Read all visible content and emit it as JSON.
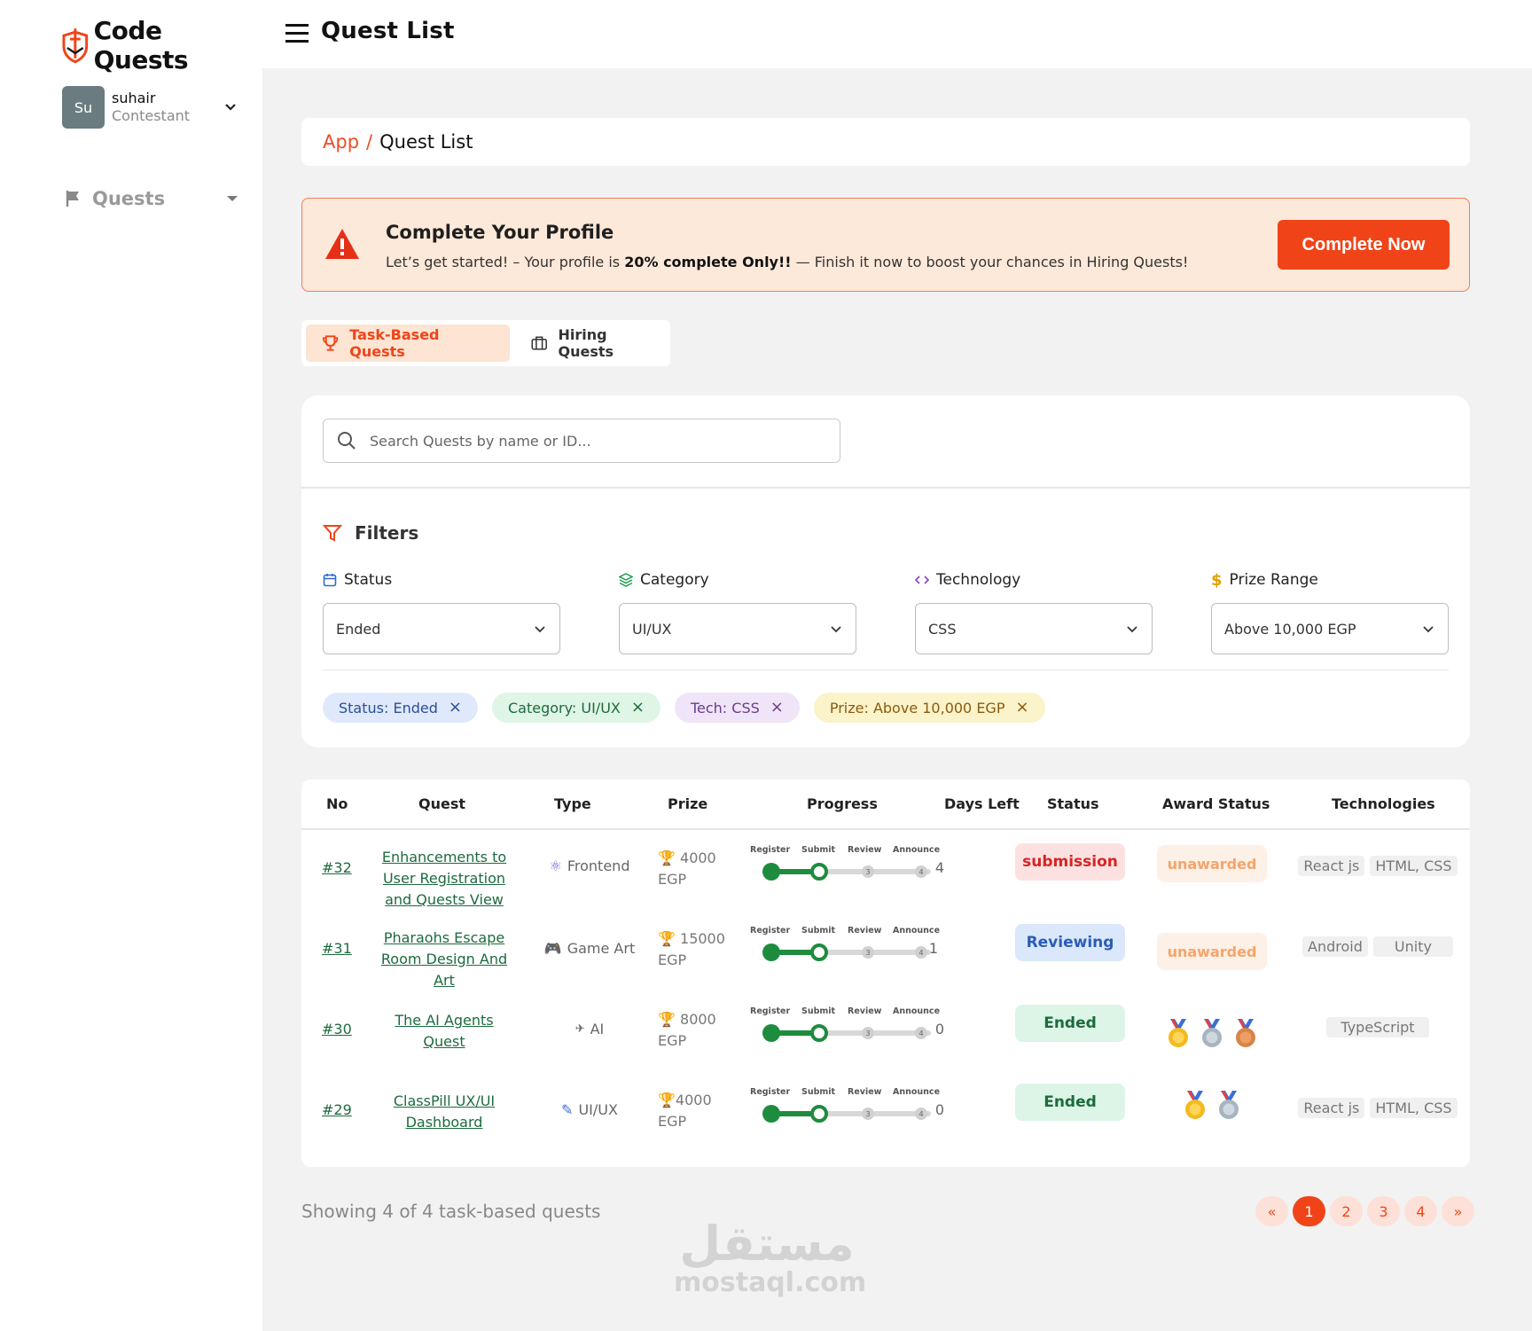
{
  "brand": {
    "name": "Code Quests",
    "accent": "#f04418"
  },
  "user": {
    "initials": "Su",
    "name": "suhair",
    "role": "Contestant"
  },
  "sidebar": {
    "items": [
      {
        "label": "Quests",
        "icon": "flag-icon"
      }
    ]
  },
  "header": {
    "title": "Quest List"
  },
  "breadcrumb": {
    "root": "App",
    "separator": "/",
    "current": "Quest List"
  },
  "alert": {
    "title": "Complete Your Profile",
    "text_before": "Let’s get started! – Your profile is ",
    "text_bold": "20% complete Only!!",
    "text_after": " — Finish it now to boost your chances in Hiring Quests!",
    "button": "Complete Now"
  },
  "tabs": [
    {
      "label": "Task-Based Quests",
      "icon": "trophy-icon",
      "active": true
    },
    {
      "label": "Hiring Quests",
      "icon": "briefcase-icon",
      "active": false
    }
  ],
  "search": {
    "placeholder": "Search Quests by name or ID..."
  },
  "filters": {
    "title": "Filters",
    "groups": [
      {
        "label": "Status",
        "icon": "calendar-icon",
        "value": "Ended"
      },
      {
        "label": "Category",
        "icon": "layers-icon",
        "value": "UI/UX"
      },
      {
        "label": "Technology",
        "icon": "code-icon",
        "value": "CSS"
      },
      {
        "label": "Prize Range",
        "icon": "dollar-icon",
        "value": "Above 10,000 EGP"
      }
    ],
    "chips": [
      {
        "label": "Status: Ended"
      },
      {
        "label": "Category: UI/UX"
      },
      {
        "label": "Tech: CSS"
      },
      {
        "label": "Prize: Above 10,000 EGP"
      }
    ]
  },
  "table": {
    "headers": [
      "No",
      "Quest",
      "Type",
      "Prize",
      "Progress",
      "Days Left",
      "Status",
      "Award Status",
      "Technologies"
    ],
    "progress_steps": [
      "Register",
      "Submit",
      "Review",
      "Announce"
    ],
    "rows": [
      {
        "no": "#32",
        "quest": "Enhancements to User Registration and Quests View",
        "type_icon": "⚛",
        "type": "Frontend",
        "prize_amount": "🏆 4000",
        "prize_currency": "EGP",
        "days": "4",
        "status": "submission",
        "award": "unawarded",
        "techs": [
          "React js",
          "HTML, CSS"
        ]
      },
      {
        "no": "#31",
        "quest": "Pharaohs Escape Room Design And Art",
        "type_icon": "🎮",
        "type": "Game Art",
        "prize_amount": "🏆 15000",
        "prize_currency": "EGP",
        "days": "1",
        "status": "Reviewing",
        "award": "unawarded",
        "techs": [
          "Android",
          "Unity"
        ]
      },
      {
        "no": "#30",
        "quest": "The AI Agents Quest",
        "type_icon": "✈",
        "type": "AI",
        "prize_amount": "🏆 8000",
        "prize_currency": "EGP",
        "days": "0",
        "status": "Ended",
        "award": "medals",
        "techs": [
          "TypeScript"
        ]
      },
      {
        "no": "#29",
        "quest": "ClassPill UX/UI Dashboard",
        "type_icon": "✎",
        "type": "UI/UX",
        "prize_amount": "🏆4000",
        "prize_currency": "EGP",
        "days": "0",
        "status": "Ended",
        "award": "medals",
        "techs": [
          "React js",
          "HTML, CSS"
        ]
      }
    ]
  },
  "footer": {
    "showing": "Showing 4 of 4 task-based quests",
    "pages": [
      "«",
      "1",
      "2",
      "3",
      "4",
      "»"
    ]
  },
  "watermark": {
    "arabic": "مستقل",
    "latin": "mostaql.com"
  }
}
